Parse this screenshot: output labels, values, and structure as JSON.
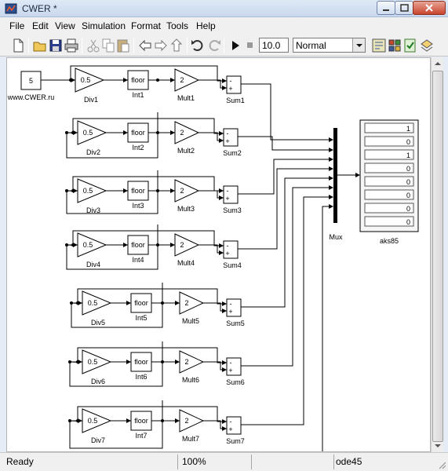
{
  "window": {
    "title": "CWER *"
  },
  "menu": [
    "File",
    "Edit",
    "View",
    "Simulation",
    "Format",
    "Tools",
    "Help"
  ],
  "toolbar": {
    "stop_time": "10.0",
    "mode": "Normal"
  },
  "model": {
    "constant": {
      "value": "5",
      "caption": "www.CWER.ru"
    },
    "gain_value": "0.5",
    "floor_text": "floor",
    "mult_value": "2",
    "sum_signs": [
      "-",
      "+"
    ],
    "rows": [
      {
        "div": "Div1",
        "int": "Int1",
        "mult": "Mult1",
        "sum": "Sum1"
      },
      {
        "div": "Div2",
        "int": "Int2",
        "mult": "Mult2",
        "sum": "Sum2"
      },
      {
        "div": "Div3",
        "int": "Int3",
        "mult": "Mult3",
        "sum": "Sum3"
      },
      {
        "div": "Div4",
        "int": "Int4",
        "mult": "Mult4",
        "sum": "Sum4"
      },
      {
        "div": "Div5",
        "int": "Int5",
        "mult": "Mult5",
        "sum": "Sum5"
      },
      {
        "div": "Div6",
        "int": "Int6",
        "mult": "Mult6",
        "sum": "Sum6"
      },
      {
        "div": "Div7",
        "int": "Int7",
        "mult": "Mult7",
        "sum": "Sum7"
      }
    ],
    "mux_label": "Mux",
    "display": {
      "label": "aks85",
      "values": [
        "1",
        "0",
        "1",
        "0",
        "0",
        "0",
        "0",
        "0"
      ]
    }
  },
  "status": {
    "state": "Ready",
    "zoom": "100%",
    "solver": "ode45"
  }
}
